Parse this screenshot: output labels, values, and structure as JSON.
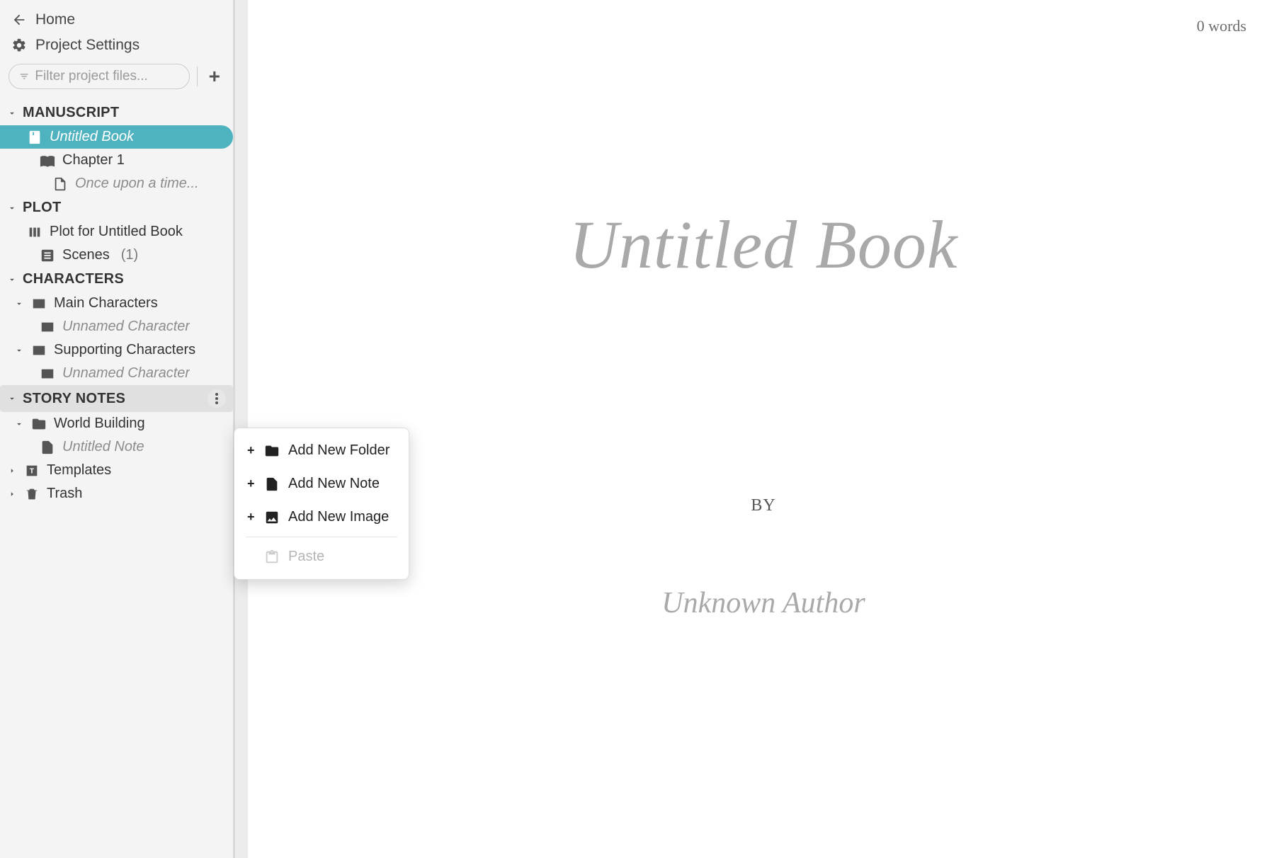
{
  "nav": {
    "home": "Home",
    "settings": "Project Settings"
  },
  "filter": {
    "placeholder": "Filter project files..."
  },
  "sections": {
    "manuscript": {
      "label": "MANUSCRIPT",
      "book": "Untitled Book",
      "chapter": "Chapter 1",
      "scene": "Once upon a time..."
    },
    "plot": {
      "label": "PLOT",
      "plotfor": "Plot for Untitled Book",
      "scenes": "Scenes",
      "scenes_count": "(1)"
    },
    "characters": {
      "label": "CHARACTERS",
      "main": "Main Characters",
      "main_unnamed": "Unnamed Character",
      "supporting": "Supporting Characters",
      "supporting_unnamed": "Unnamed Character"
    },
    "storynotes": {
      "label": "STORY NOTES",
      "world": "World Building",
      "note": "Untitled Note"
    },
    "templates": "Templates",
    "trash": "Trash"
  },
  "context_menu": {
    "add_folder": "Add New Folder",
    "add_note": "Add New Note",
    "add_image": "Add New Image",
    "paste": "Paste"
  },
  "editor": {
    "wordcount": "0 words",
    "title": "Untitled Book",
    "by": "BY",
    "author": "Unknown Author"
  }
}
